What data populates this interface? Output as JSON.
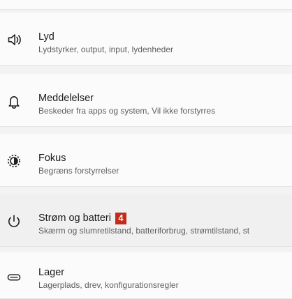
{
  "settings": {
    "items": [
      {
        "id": "sound",
        "title": "Lyd",
        "subtitle": "Lydstyrker, output, input, lydenheder",
        "icon": "speaker-icon"
      },
      {
        "id": "notifications",
        "title": "Meddelelser",
        "subtitle": "Beskeder fra apps og system, Vil ikke forstyrres",
        "icon": "bell-icon"
      },
      {
        "id": "focus",
        "title": "Fokus",
        "subtitle": "Begræns forstyrrelser",
        "icon": "focus-icon"
      },
      {
        "id": "power",
        "title": "Strøm og batteri",
        "badge": "4",
        "subtitle": "Skærm og slumretilstand, batteriforbrug, strømtilstand, st",
        "icon": "power-icon"
      },
      {
        "id": "storage",
        "title": "Lager",
        "subtitle": "Lagerplads, drev, konfigurationsregler",
        "icon": "storage-icon"
      }
    ]
  },
  "colors": {
    "background": "#f3f3f3",
    "card": "#fbfbfb",
    "hover_card": "#f0f0f0",
    "badge": "#c42b1c",
    "title_text": "#1b1b1b",
    "subtitle_text": "#5f5f5f"
  }
}
